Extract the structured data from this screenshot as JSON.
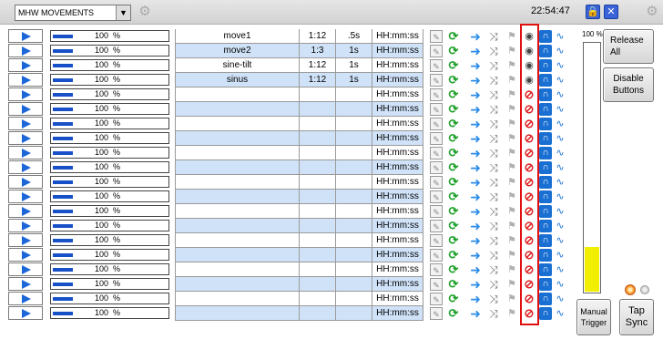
{
  "topbar": {
    "preset_select": "MHW MOVEMENTS",
    "clock": "22:54:47",
    "lock_icon": "lock-icon",
    "close_icon": "close-icon"
  },
  "rows": [
    {
      "progress": "100  %",
      "name": "move1",
      "ratio": "1:12",
      "duration": ".5s",
      "time": "HH:mm:ss",
      "active": true
    },
    {
      "progress": "100  %",
      "name": "move2",
      "ratio": "1:3",
      "duration": "1s",
      "time": "HH:mm:ss",
      "active": true
    },
    {
      "progress": "100  %",
      "name": "sine-tilt",
      "ratio": "1:12",
      "duration": "1s",
      "time": "HH:mm:ss",
      "active": true
    },
    {
      "progress": "100  %",
      "name": "sinus",
      "ratio": "1:12",
      "duration": "1s",
      "time": "HH:mm:ss",
      "active": true
    },
    {
      "progress": "100  %",
      "name": "",
      "ratio": "",
      "duration": "",
      "time": "HH:mm:ss",
      "active": false
    },
    {
      "progress": "100  %",
      "name": "",
      "ratio": "",
      "duration": "",
      "time": "HH:mm:ss",
      "active": false
    },
    {
      "progress": "100  %",
      "name": "",
      "ratio": "",
      "duration": "",
      "time": "HH:mm:ss",
      "active": false
    },
    {
      "progress": "100  %",
      "name": "",
      "ratio": "",
      "duration": "",
      "time": "HH:mm:ss",
      "active": false
    },
    {
      "progress": "100  %",
      "name": "",
      "ratio": "",
      "duration": "",
      "time": "HH:mm:ss",
      "active": false
    },
    {
      "progress": "100  %",
      "name": "",
      "ratio": "",
      "duration": "",
      "time": "HH:mm:ss",
      "active": false
    },
    {
      "progress": "100  %",
      "name": "",
      "ratio": "",
      "duration": "",
      "time": "HH:mm:ss",
      "active": false
    },
    {
      "progress": "100  %",
      "name": "",
      "ratio": "",
      "duration": "",
      "time": "HH:mm:ss",
      "active": false
    },
    {
      "progress": "100  %",
      "name": "",
      "ratio": "",
      "duration": "",
      "time": "HH:mm:ss",
      "active": false
    },
    {
      "progress": "100  %",
      "name": "",
      "ratio": "",
      "duration": "",
      "time": "HH:mm:ss",
      "active": false
    },
    {
      "progress": "100  %",
      "name": "",
      "ratio": "",
      "duration": "",
      "time": "HH:mm:ss",
      "active": false
    },
    {
      "progress": "100  %",
      "name": "",
      "ratio": "",
      "duration": "",
      "time": "HH:mm:ss",
      "active": false
    },
    {
      "progress": "100  %",
      "name": "",
      "ratio": "",
      "duration": "",
      "time": "HH:mm:ss",
      "active": false
    },
    {
      "progress": "100  %",
      "name": "",
      "ratio": "",
      "duration": "",
      "time": "HH:mm:ss",
      "active": false
    },
    {
      "progress": "100  %",
      "name": "",
      "ratio": "",
      "duration": "",
      "time": "HH:mm:ss",
      "active": false
    },
    {
      "progress": "100  %",
      "name": "",
      "ratio": "",
      "duration": "",
      "time": "HH:mm:ss",
      "active": false
    }
  ],
  "right_panel": {
    "meter_label": "100 %",
    "meter_level": 0.18,
    "release_all": "Release All",
    "disable_buttons": "Disable Buttons",
    "manual_trigger": "Manual Trigger",
    "tap_sync": "Tap Sync"
  },
  "colors": {
    "highlight_box": "#e01010",
    "row_tint": "#cfe2f8",
    "meter_fill": "#f2ee00",
    "accent_blue": "#1c66d8"
  }
}
